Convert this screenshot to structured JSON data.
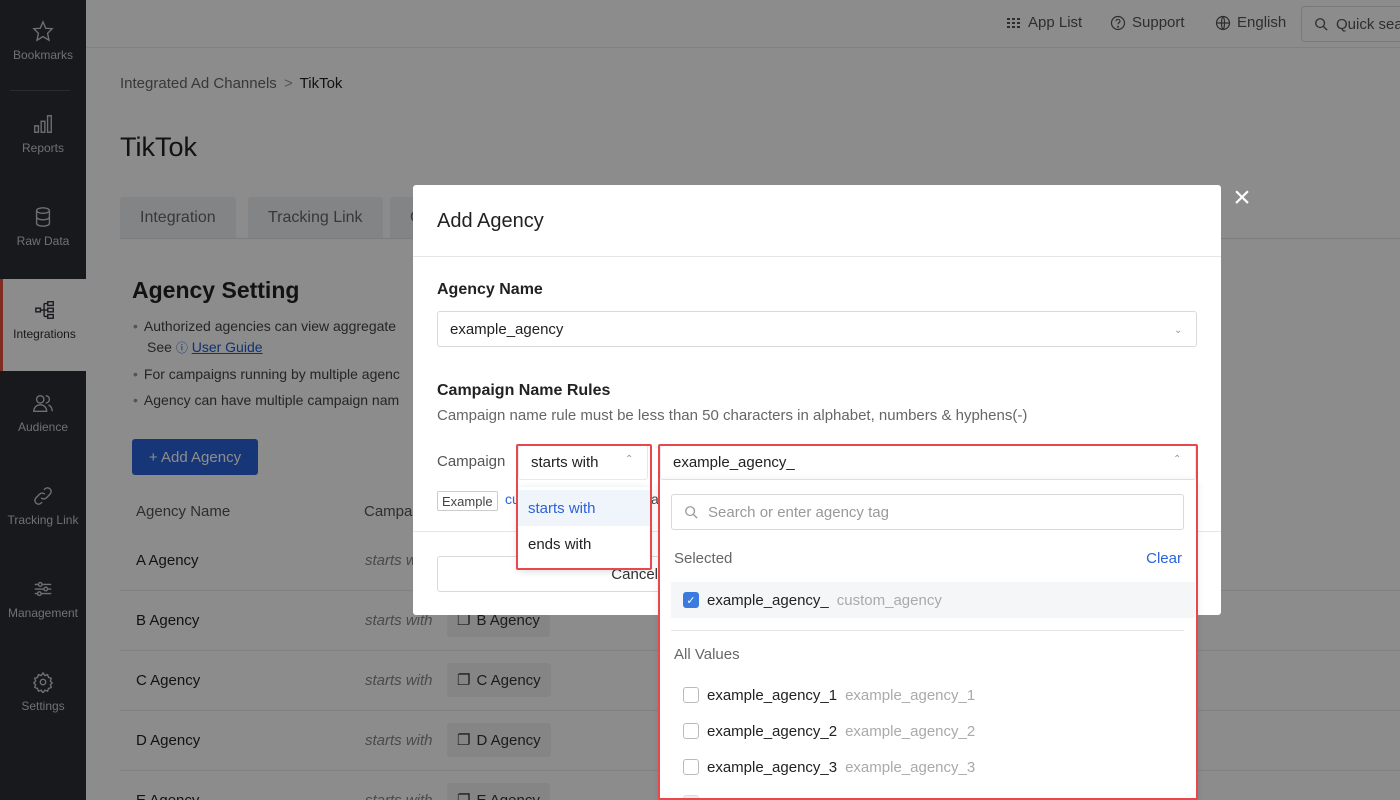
{
  "sidebar": {
    "items": [
      {
        "label": "Bookmarks",
        "icon": "star-icon"
      },
      {
        "label": "Reports",
        "icon": "bar-chart-icon"
      },
      {
        "label": "Raw Data",
        "icon": "database-icon"
      },
      {
        "label": "Integrations",
        "icon": "integrations-icon",
        "active": true
      },
      {
        "label": "Audience",
        "icon": "audience-icon"
      },
      {
        "label": "Tracking Link",
        "icon": "link-icon"
      },
      {
        "label": "Management",
        "icon": "sliders-icon"
      },
      {
        "label": "Settings",
        "icon": "gear-icon"
      }
    ]
  },
  "topbar": {
    "app_list": "App List",
    "support": "Support",
    "language": "English",
    "quick_search": "Quick sea"
  },
  "breadcrumb": {
    "parent": "Integrated Ad Channels",
    "separator": ">",
    "current": "TikTok"
  },
  "page": {
    "title": "TikTok",
    "tabs": [
      "Integration",
      "Tracking Link",
      "C"
    ],
    "section_title": "Agency Setting",
    "bullets": [
      "Authorized agencies can view aggregate",
      "For campaigns running by multiple agenc",
      "Agency can have multiple campaign nam"
    ],
    "see_text": "See",
    "user_guide": "User Guide",
    "add_agency_btn": "+ Add Agency",
    "table": {
      "headers": [
        "Agency Name",
        "Campai"
      ],
      "rows": [
        {
          "name": "A Agency",
          "rule": "starts w",
          "tag": ""
        },
        {
          "name": "B Agency",
          "rule": "starts with",
          "tag": "B Agency"
        },
        {
          "name": "C Agency",
          "rule": "starts with",
          "tag": "C Agency"
        },
        {
          "name": "D Agency",
          "rule": "starts with",
          "tag": "D Agency"
        },
        {
          "name": "E Agency",
          "rule": "starts with",
          "tag": "E Agency"
        }
      ]
    }
  },
  "modal": {
    "title": "Add Agency",
    "agency_name_label": "Agency Name",
    "agency_name_value": "example_agency",
    "campaign_rules_label": "Campaign Name Rules",
    "helper": "Campaign name rule must be less than 50 characters in alphabet, numbers & hyphens(-)",
    "campaign_label": "Campaign",
    "rule_value": "starts with",
    "tag_value": "example_agency_",
    "example_tag": "Example",
    "example_after": "cu",
    "example_mid": "a",
    "cancel": "Cancel",
    "close": "×"
  },
  "rule_menu": {
    "options": [
      "starts with",
      "ends with"
    ],
    "selected_index": 0
  },
  "agency_menu": {
    "search_placeholder": "Search or enter agency tag",
    "selected_label": "Selected",
    "clear": "Clear",
    "selected": [
      {
        "value": "example_agency_",
        "sub": "custom_agency",
        "checked": true
      }
    ],
    "all_label": "All Values",
    "all": [
      {
        "value": "example_agency_1",
        "sub": "example_agency_1"
      },
      {
        "value": "example_agency_2",
        "sub": "example_agency_2"
      },
      {
        "value": "example_agency_3",
        "sub": "example_agency_3"
      }
    ]
  },
  "colors": {
    "sidebar_bg": "#2a2e35",
    "primary": "#2b63d9",
    "highlight": "#e8484b"
  }
}
